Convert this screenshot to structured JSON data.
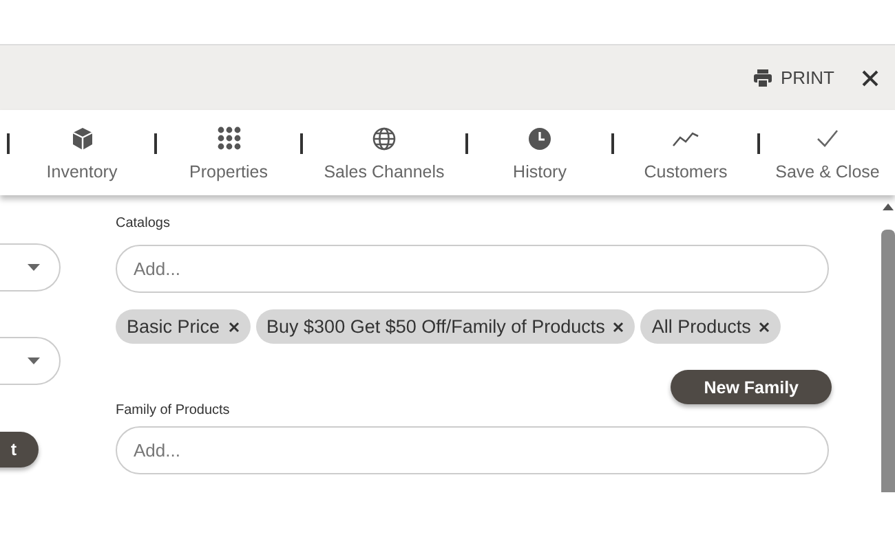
{
  "header": {
    "print_label": "PRINT"
  },
  "toolbar": [
    {
      "label": "Inventory",
      "kind": "cube"
    },
    {
      "label": "Properties",
      "kind": "grid"
    },
    {
      "label": "Sales Channels",
      "kind": "globe"
    },
    {
      "label": "History",
      "kind": "clock"
    },
    {
      "label": "Customers",
      "kind": "trend"
    },
    {
      "label": "Save & Close",
      "kind": "check"
    }
  ],
  "left_panel": {
    "dropdowns": [
      {
        "kind": "dropdown"
      },
      {
        "kind": "dropdown"
      }
    ],
    "button": "t"
  },
  "catalogs": {
    "label": "Catalogs",
    "placeholder": "Add...",
    "chips": [
      {
        "label": "Basic Price"
      },
      {
        "label": "Buy $300 Get $50 Off/Family of Products"
      },
      {
        "label": "All Products"
      }
    ]
  },
  "family": {
    "label": "Family of Products",
    "placeholder": "Add...",
    "button": "New Family"
  }
}
